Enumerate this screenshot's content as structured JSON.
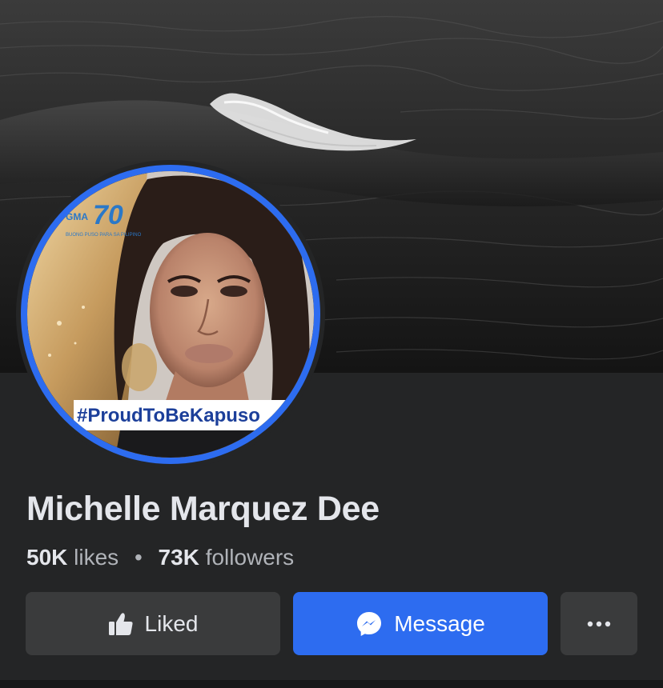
{
  "page": {
    "name": "Michelle Marquez Dee",
    "likes_count": "50K",
    "likes_label": "likes",
    "separator": "•",
    "followers_count": "73K",
    "followers_label": "followers"
  },
  "profile_picture": {
    "hashtag": "#ProudToBeKapuso",
    "logo_brand": "GMA",
    "logo_number": "70",
    "logo_tagline": "BUONG PUSO PARA SA PILIPINO"
  },
  "actions": {
    "liked_label": "Liked",
    "liked_icon": "thumbs-up-icon",
    "message_label": "Message",
    "message_icon": "messenger-icon",
    "more_icon": "more-horizontal-icon"
  },
  "colors": {
    "accent": "#2d6cf0",
    "background": "#242526",
    "button_secondary": "#3a3b3c",
    "text_primary": "#e4e6eb",
    "text_secondary": "#b0b3b8"
  }
}
